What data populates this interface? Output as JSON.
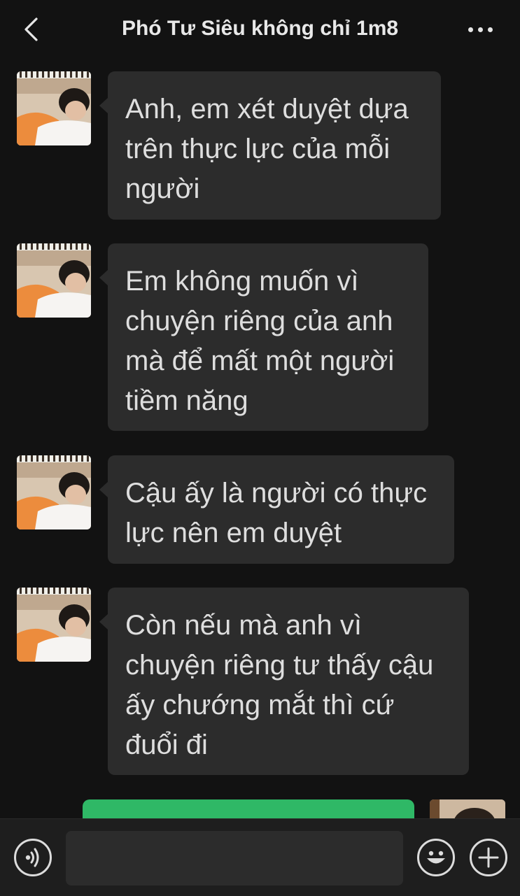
{
  "header": {
    "title": "Phó Tư Siêu không chỉ 1m8",
    "back_icon": "chevron-left-icon",
    "more_icon": "more-horizontal-icon"
  },
  "messages": [
    {
      "direction": "incoming",
      "text": "Anh, em xét duyệt dựa\ntrên thực lực của mỗi\nngười"
    },
    {
      "direction": "incoming",
      "text": "Em không muốn vì\nchuyện riêng của anh\nmà để mất một người\ntiềm năng"
    },
    {
      "direction": "incoming",
      "text": "Cậu ấy là người có thực\nlực nên em duyệt"
    },
    {
      "direction": "incoming",
      "text": "Còn nếu mà anh vì\nchuyện riêng tư thấy cậu\nấy chướng mắt thì cứ\nđuổi đi"
    },
    {
      "direction": "outgoing",
      "text": ""
    }
  ],
  "input_bar": {
    "voice_icon": "voice-icon",
    "input_value": "",
    "emoji_icon": "emoji-icon",
    "plus_icon": "plus-icon"
  },
  "colors": {
    "background": "#121212",
    "incoming_bubble": "#2c2c2c",
    "outgoing_bubble": "#2fb866",
    "text": "#dedede"
  }
}
